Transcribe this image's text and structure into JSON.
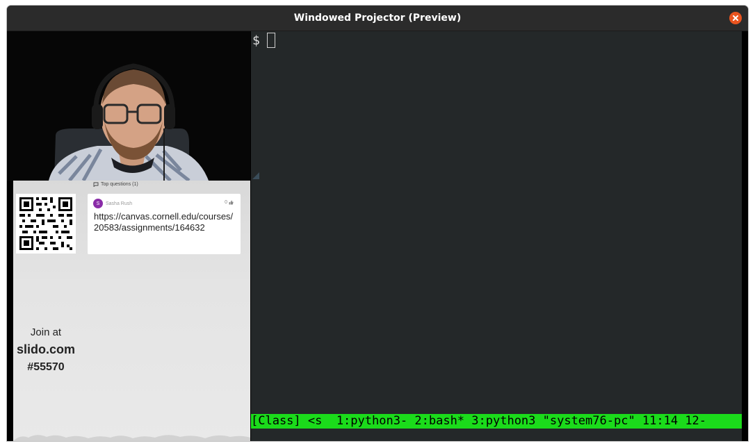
{
  "window": {
    "title": "Windowed Projector (Preview)"
  },
  "slido": {
    "top_questions_label": "Top questions (1)",
    "question": {
      "author_initial": "S",
      "author_name": "Sasha Rush",
      "likes": "0",
      "text": "https://canvas.cornell.edu/courses/20583/assignments/164632"
    },
    "join_at": "Join at",
    "domain": "slido.com",
    "event_code": "#55570"
  },
  "terminal": {
    "prompt": "$",
    "status_line": "[Class] <s  1:python3- 2:bash* 3:python3 \"system76-pc\" 11:14 12-"
  },
  "colors": {
    "titlebar": "#2b2b2b",
    "close_button": "#e9541f",
    "terminal_bg": "#242829",
    "tmux_status": "#1bdb1b",
    "avatar": "#8a2ca8"
  },
  "icons": {
    "close": "close-icon",
    "speech_bubble": "speech-bubble-icon",
    "thumbs_up": "thumbs-up-icon",
    "qr_code": "qr-code-icon"
  }
}
